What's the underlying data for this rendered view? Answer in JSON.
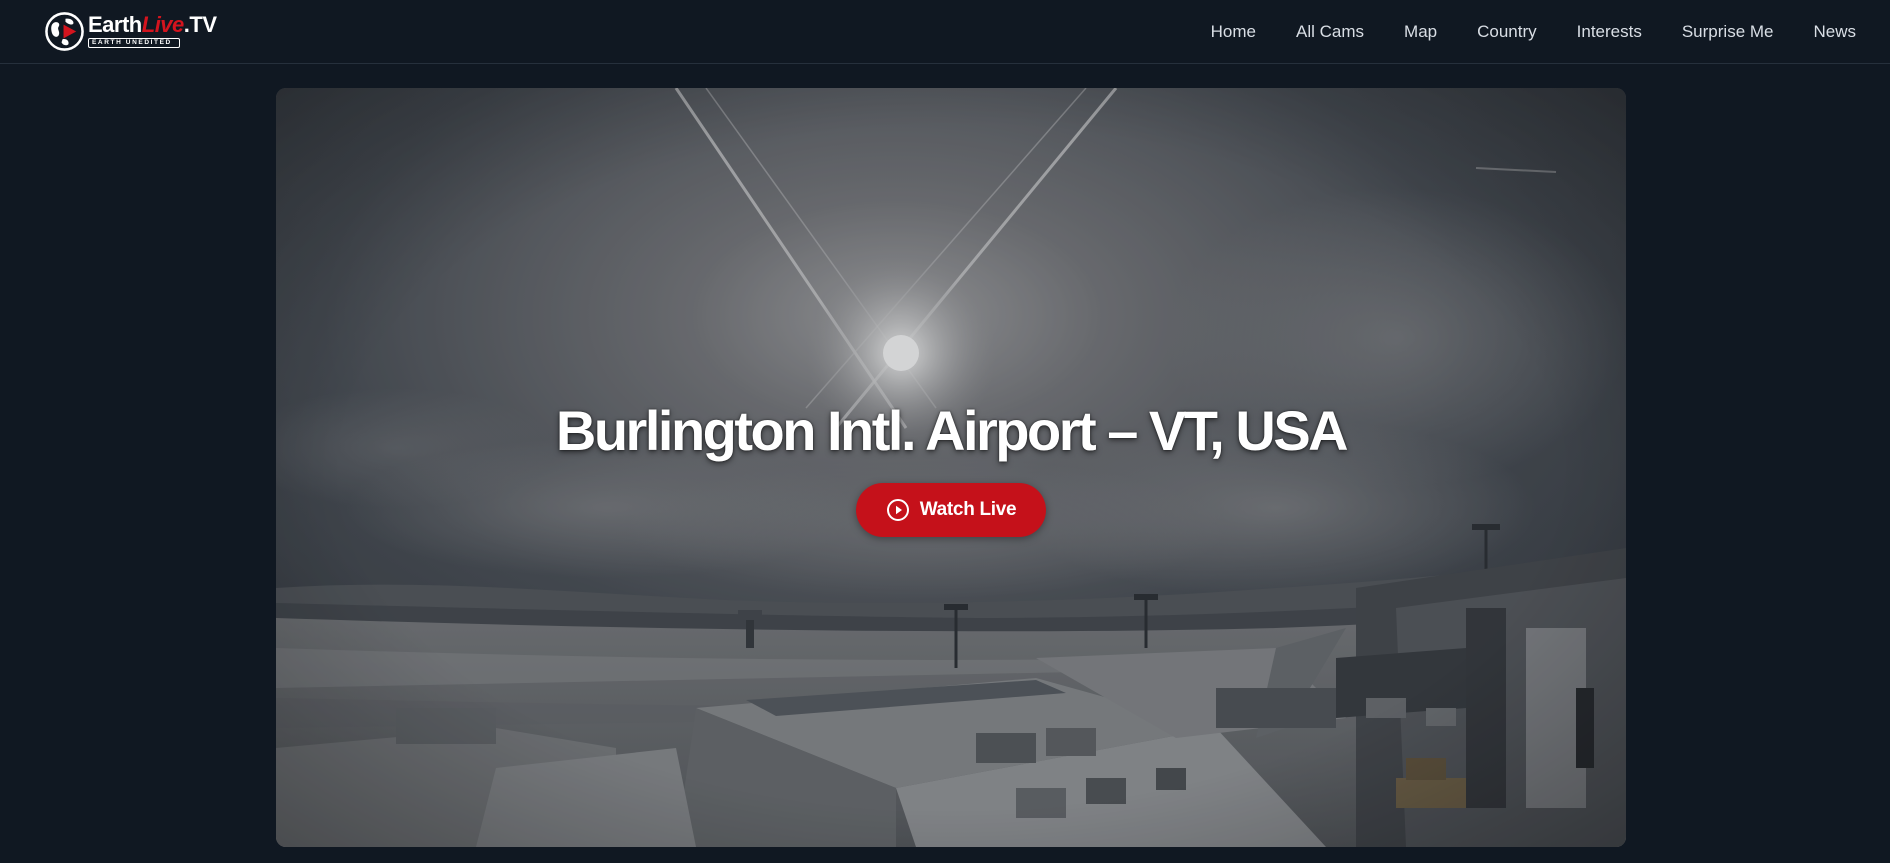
{
  "header": {
    "logo": {
      "word_earth": "Earth",
      "word_live": "Live",
      "word_tv": ".TV",
      "tagline": "EARTH UNEDITED"
    },
    "nav": [
      {
        "label": "Home"
      },
      {
        "label": "All Cams"
      },
      {
        "label": "Map"
      },
      {
        "label": "Country"
      },
      {
        "label": "Interests"
      },
      {
        "label": "Surprise Me"
      },
      {
        "label": "News"
      }
    ]
  },
  "hero": {
    "title": "Burlington Intl. Airport – VT, USA",
    "watch_label": "Watch Live",
    "image_subject": "airport webcam view with sun and snowy rooftops"
  },
  "colors": {
    "background": "#101822",
    "accent": "#c5111a",
    "logo_live": "#d4141e"
  },
  "icons": {
    "logo": "globe-play-icon",
    "watch": "play-circle-icon"
  }
}
